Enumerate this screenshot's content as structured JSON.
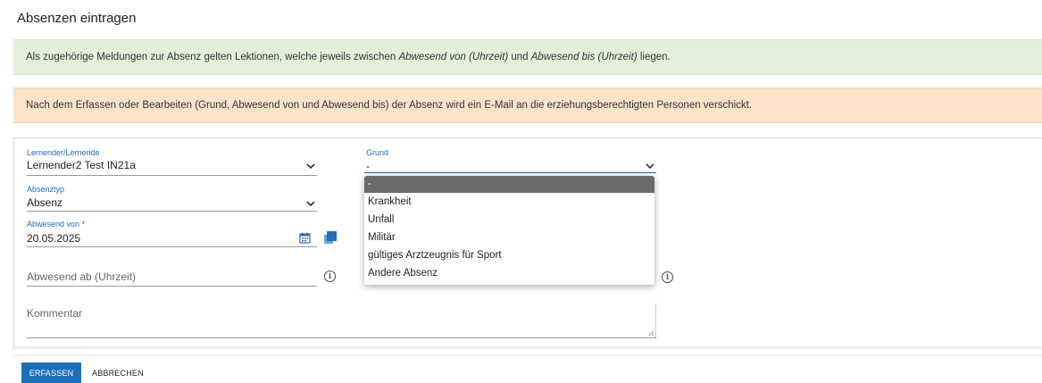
{
  "page": {
    "title": "Absenzen eintragen"
  },
  "alerts": {
    "info": {
      "part1": "Als zugehörige Meldungen zur Absenz gelten Lektionen, welche jeweils zwischen ",
      "em1": "Abwesend von (Uhrzeit)",
      "part2": " und ",
      "em2": "Abwesend bis (Uhrzeit)",
      "part3": " liegen."
    },
    "warning": "Nach dem Erfassen oder Bearbeiten (Grund, Abwesend von und Abwesend bis) der Absenz wird ein E-Mail an die erziehungsberechtigten Personen verschickt."
  },
  "form": {
    "lernender": {
      "label": "Lernender/Lernende",
      "value": "Lernender2 Test IN21a"
    },
    "grund": {
      "label": "Grund",
      "value": "-"
    },
    "absenztyp": {
      "label": "Absenztyp",
      "value": "Absenz"
    },
    "abwesend_von": {
      "label": "Abwesend von *",
      "value": "20.05.2025"
    },
    "abwesend_ab": {
      "placeholder": "Abwesend ab (Uhrzeit)"
    },
    "kommentar": {
      "placeholder": "Kommentar"
    }
  },
  "grund_dropdown": {
    "options": [
      "-",
      "Krankheit",
      "Unfall",
      "Militär",
      "gültiges Arztzeugnis für Sport",
      "Andere Absenz"
    ],
    "selected_index": 0
  },
  "buttons": {
    "submit": "ERFASSEN",
    "cancel": "ABBRECHEN"
  },
  "colors": {
    "accent": "#1d6fb8",
    "info_bg": "#e4efd9",
    "warning_bg": "#fbe3ca"
  }
}
